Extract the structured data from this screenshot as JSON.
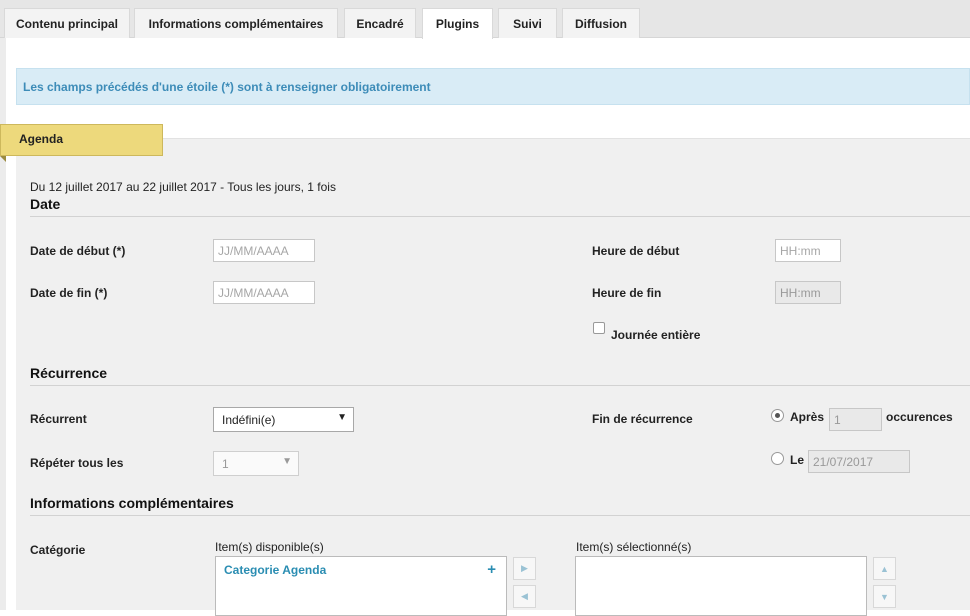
{
  "tabs": [
    {
      "label": "Contenu principal"
    },
    {
      "label": "Informations complémentaires"
    },
    {
      "label": "Encadré"
    },
    {
      "label": "Plugins"
    },
    {
      "label": "Suivi"
    },
    {
      "label": "Diffusion"
    }
  ],
  "active_tab": "Plugins",
  "notice": "Les champs précédés d'une étoile (*) sont à renseigner obligatoirement",
  "section": "Agenda",
  "summary": "Du 12 juillet 2017 au 22 juillet 2017 - Tous les jours, 1 fois",
  "date": {
    "title": "Date",
    "start_label": "Date de début (*)",
    "start_placeholder": "JJ/MM/AAAA",
    "end_label": "Date de fin (*)",
    "end_placeholder": "JJ/MM/AAAA",
    "start_time_label": "Heure de début",
    "start_time_placeholder": "HH:mm",
    "end_time_label": "Heure de fin",
    "end_time_placeholder": "HH:mm",
    "all_day_label": "Journée entière"
  },
  "recurrence": {
    "title": "Récurrence",
    "recurrent_label": "Récurrent",
    "recurrent_value": "Indéfini(e)",
    "repeat_label": "Répéter tous les",
    "repeat_value": "1",
    "end_label": "Fin de récurrence",
    "after_label": "Après",
    "after_value": "1",
    "occurrences_label": "occurences",
    "on_label": "Le",
    "on_value": "21/07/2017"
  },
  "info": {
    "title": "Informations complémentaires",
    "category_label": "Catégorie",
    "available_label": "Item(s) disponible(s)",
    "selected_label": "Item(s) sélectionné(s)",
    "available_items": [
      "Categorie Agenda"
    ],
    "add_symbol": "+"
  },
  "icons": {
    "move_right": "triangle-right",
    "move_left": "triangle-left",
    "move_up": "triangle-up",
    "move_down": "triangle-down"
  },
  "colors": {
    "notice_bg": "#d9ecf6",
    "notice_text": "#3d8cb8",
    "ribbon": "#edd97c",
    "link": "#2a8db2",
    "panel_bg": "#f0f0f0"
  }
}
